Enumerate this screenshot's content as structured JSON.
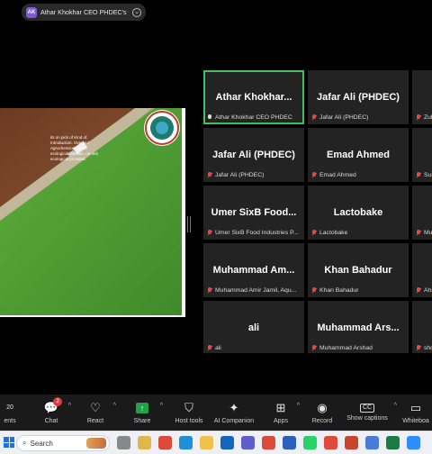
{
  "share_banner": {
    "initials": "AK",
    "text": "Athar Khokhar CEO PHDEC's scre",
    "chevron": "⌄"
  },
  "shared_screen": {
    "overlay_text": "its on pick of Kind of. Introduction. Overlaid Agrochemicals gone ecological solution. on unit ecological provided.",
    "logo_name": "shield-logo"
  },
  "participants": [
    {
      "name": "Athar  Khokhar...",
      "label": "Athar Khokhar CEO PHDEC",
      "muted": false,
      "active": true
    },
    {
      "name": "Jafar Ali (PHDEC)",
      "label": "Jafar Ali (PHDEC)",
      "muted": true,
      "active": false
    },
    {
      "name": "Zulq",
      "label": "Zulqarna",
      "muted": true,
      "active": false
    },
    {
      "name": "Jafar Ali (PHDEC)",
      "label": "Jafar Ali (PHDEC)",
      "muted": true,
      "active": false
    },
    {
      "name": "Emad Ahmed",
      "label": "Emad Ahmed",
      "muted": true,
      "active": false
    },
    {
      "name": "Sun",
      "label": "Sun",
      "muted": true,
      "active": false
    },
    {
      "name": "Umer SixB Food...",
      "label": "Umer SixB Food Industries P...",
      "muted": true,
      "active": false
    },
    {
      "name": "Lactobake",
      "label": "Lactobake",
      "muted": true,
      "active": false
    },
    {
      "name": "Muh",
      "label": "Muh",
      "muted": true,
      "active": false
    },
    {
      "name": "Muhammad  Am...",
      "label": "Muhammad Amir Jamil, Aqu...",
      "muted": true,
      "active": false
    },
    {
      "name": "Khan Bahadur",
      "label": "Khan Bahadur",
      "muted": true,
      "active": false
    },
    {
      "name": "Ahm",
      "label": "Ahm",
      "muted": true,
      "active": false
    },
    {
      "name": "ali",
      "label": "ali",
      "muted": true,
      "active": false
    },
    {
      "name": "Muhammad  Ars...",
      "label": "Muhammad Arshad",
      "muted": true,
      "active": false
    },
    {
      "name": "sh",
      "label": "shoa",
      "muted": true,
      "active": false
    }
  ],
  "toolbar": {
    "participants_count": "20",
    "participants_label": "ents",
    "chat_label": "Chat",
    "chat_badge": "2",
    "react_label": "React",
    "share_label": "Share",
    "host_tools_label": "Host tools",
    "ai_label": "AI Companion",
    "apps_label": "Apps",
    "record_label": "Record",
    "captions_label": "Show captions",
    "whiteboards_label": "Whiteboa",
    "icons": {
      "chat": "chat-icon",
      "react": "heart-icon",
      "share": "share-arrow-icon",
      "host": "shield-icon",
      "ai": "sparkle-icon",
      "apps": "apps-grid-icon",
      "record": "record-icon",
      "captions": "cc-icon",
      "whiteboards": "whiteboard-icon"
    }
  },
  "taskbar": {
    "search_placeholder": "Search",
    "apps": [
      "task-view",
      "explorer",
      "chrome",
      "edge",
      "folder",
      "outlook",
      "teams",
      "chrome-2",
      "word",
      "whatsapp",
      "chrome-3",
      "powerpoint",
      "snipping",
      "excel",
      "zoom"
    ]
  }
}
